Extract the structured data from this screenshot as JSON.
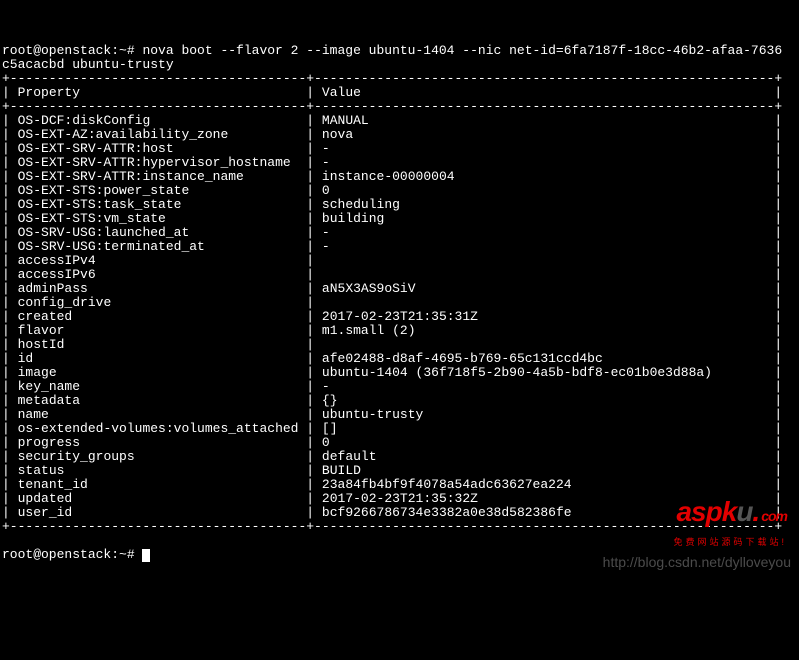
{
  "prompt1": "root@openstack:~# ",
  "command": "nova boot --flavor 2 --image ubuntu-1404 --nic net-id=6fa7187f-18cc-46b2-afaa-7636",
  "command_cont": "c5acacbd ubuntu-trusty",
  "header": {
    "prop": "Property",
    "val": "Value"
  },
  "rows": [
    {
      "p": "OS-DCF:diskConfig",
      "v": "MANUAL"
    },
    {
      "p": "OS-EXT-AZ:availability_zone",
      "v": "nova"
    },
    {
      "p": "OS-EXT-SRV-ATTR:host",
      "v": "-"
    },
    {
      "p": "OS-EXT-SRV-ATTR:hypervisor_hostname",
      "v": "-"
    },
    {
      "p": "OS-EXT-SRV-ATTR:instance_name",
      "v": "instance-00000004"
    },
    {
      "p": "OS-EXT-STS:power_state",
      "v": "0"
    },
    {
      "p": "OS-EXT-STS:task_state",
      "v": "scheduling"
    },
    {
      "p": "OS-EXT-STS:vm_state",
      "v": "building"
    },
    {
      "p": "OS-SRV-USG:launched_at",
      "v": "-"
    },
    {
      "p": "OS-SRV-USG:terminated_at",
      "v": "-"
    },
    {
      "p": "accessIPv4",
      "v": ""
    },
    {
      "p": "accessIPv6",
      "v": ""
    },
    {
      "p": "adminPass",
      "v": "aN5X3AS9oSiV"
    },
    {
      "p": "config_drive",
      "v": ""
    },
    {
      "p": "created",
      "v": "2017-02-23T21:35:31Z"
    },
    {
      "p": "flavor",
      "v": "m1.small (2)"
    },
    {
      "p": "hostId",
      "v": ""
    },
    {
      "p": "id",
      "v": "afe02488-d8af-4695-b769-65c131ccd4bc"
    },
    {
      "p": "image",
      "v": "ubuntu-1404 (36f718f5-2b90-4a5b-bdf8-ec01b0e3d88a)"
    },
    {
      "p": "key_name",
      "v": "-"
    },
    {
      "p": "metadata",
      "v": "{}"
    },
    {
      "p": "name",
      "v": "ubuntu-trusty"
    },
    {
      "p": "os-extended-volumes:volumes_attached",
      "v": "[]"
    },
    {
      "p": "progress",
      "v": "0"
    },
    {
      "p": "security_groups",
      "v": "default"
    },
    {
      "p": "status",
      "v": "BUILD"
    },
    {
      "p": "tenant_id",
      "v": "23a84fb4bf9f4078a54adc63627ea224"
    },
    {
      "p": "updated",
      "v": "2017-02-23T21:35:32Z"
    },
    {
      "p": "user_id",
      "v": "bcf9266786734e3382a0e38d582386fe"
    }
  ],
  "prompt2": "root@openstack:~# ",
  "watermark_text": "http://blog.csdn.net/dylloveyou",
  "logo": {
    "brand_a": "asp",
    "brand_k": "k",
    "brand_u": "u",
    "dot": ".",
    "tld": "com",
    "sub": "免费网站源码下载站!"
  }
}
